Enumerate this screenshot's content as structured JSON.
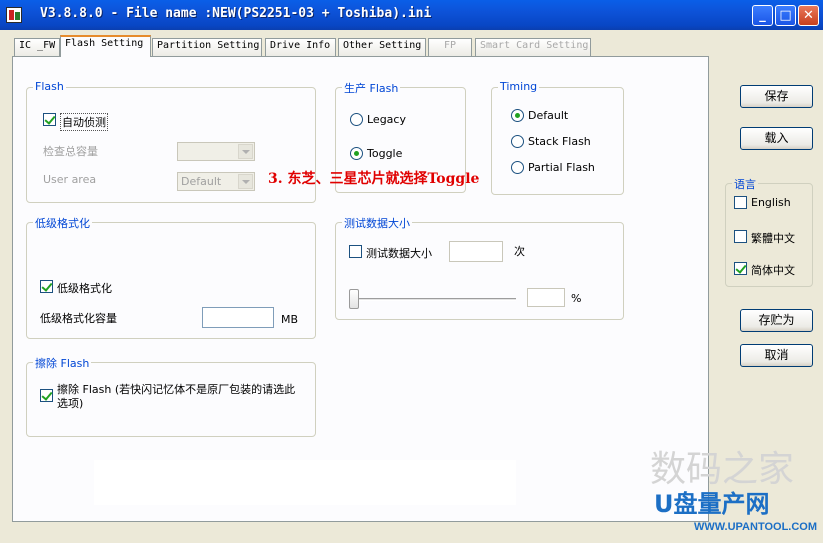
{
  "window": {
    "title": "V3.8.8.0 - File name :NEW(PS2251-03 + Toshiba).ini",
    "minimize_glyph": "_",
    "maximize_glyph": "□",
    "close_glyph": "✕"
  },
  "tabs": [
    {
      "label": "IC _FW"
    },
    {
      "label": "Flash Setting"
    },
    {
      "label": "Partition Setting"
    },
    {
      "label": "Drive Info"
    },
    {
      "label": "Other Setting"
    },
    {
      "label": "FP"
    },
    {
      "label": "Smart Card Setting"
    }
  ],
  "flash": {
    "legend": "Flash",
    "auto_detect_label": "自动侦测",
    "auto_detect_checked": true,
    "check_capacity_label": "检查总容量",
    "check_capacity_value": "",
    "user_area_label": "User area",
    "user_area_value": "Default"
  },
  "production": {
    "legend": "生产 Flash",
    "legacy_label": "Legacy",
    "toggle_label": "Toggle",
    "selected": "Toggle"
  },
  "timing": {
    "legend": "Timing",
    "default_label": "Default",
    "stack_label": "Stack Flash",
    "partial_label": "Partial Flash",
    "selected": "Default"
  },
  "lowformat": {
    "legend": "低级格式化",
    "checkbox_label": "低级格式化",
    "checked": true,
    "capacity_label": "低级格式化容量",
    "capacity_value": "",
    "unit": "MB"
  },
  "testdata": {
    "legend": "测试数据大小",
    "checkbox_label": "测试数据大小",
    "checked": false,
    "count_value": "",
    "count_unit": "次",
    "percent_value": "",
    "percent_unit": "%",
    "slider_level": 0
  },
  "erase": {
    "legend": "擦除 Flash",
    "checkbox_label": "擦除 Flash (若快闪记忆体不是原厂包装的请选此选项)",
    "checked": true
  },
  "annotation": "3. 东芝、三星芯片就选择Toggle",
  "buttons": {
    "save": "保存",
    "load": "载入",
    "save_as": "存贮为",
    "cancel": "取消"
  },
  "language": {
    "legend": "语言",
    "english": "English",
    "traditional": "繁體中文",
    "simplified": "简体中文",
    "english_checked": false,
    "traditional_checked": false,
    "simplified_checked": true
  },
  "watermark": {
    "line1": "数码之家",
    "line2": "U盘量产网",
    "url": "WWW.UPANTOOL.COM"
  },
  "colors": {
    "titlebar": "#0a5fe8",
    "legend_text": "#0046d5",
    "annotation": "#e00000",
    "check_mark": "#21a121"
  }
}
